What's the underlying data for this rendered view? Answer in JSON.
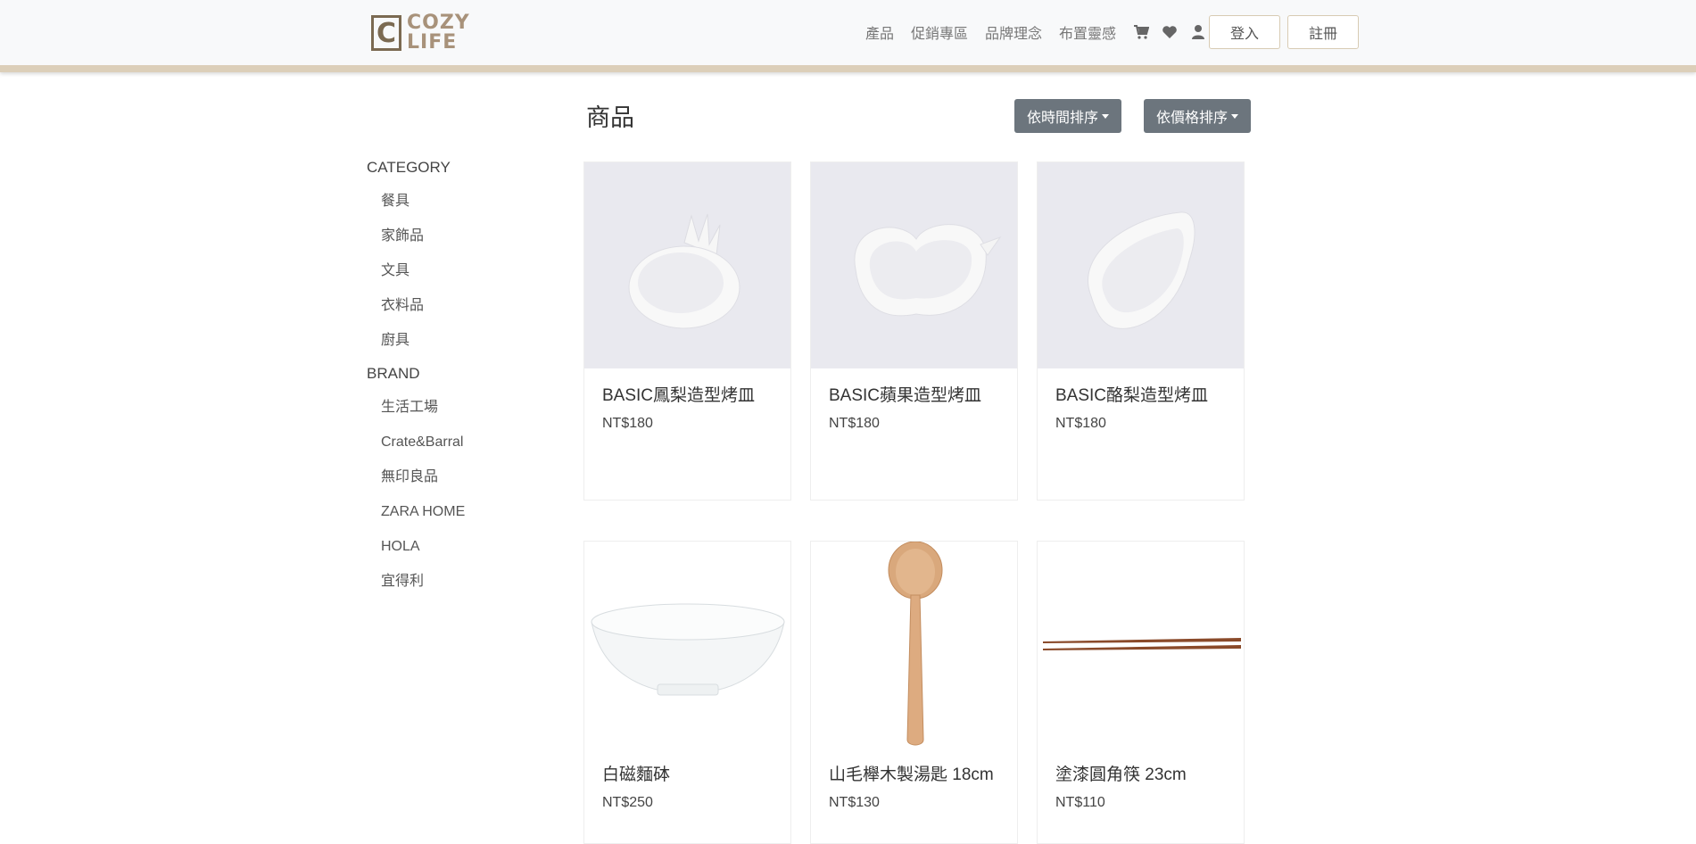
{
  "brand": {
    "logo_letter": "C",
    "line1": "COZY",
    "line2": "LIFE"
  },
  "nav": {
    "links": [
      "產品",
      "促銷專區",
      "品牌理念",
      "布置靈感"
    ],
    "icons": [
      "cart-icon",
      "heart-icon",
      "user-icon"
    ],
    "login_label": "登入",
    "register_label": "註冊"
  },
  "page": {
    "title": "商品",
    "sort_time_label": "依時間排序",
    "sort_price_label": "依價格排序"
  },
  "sidebar": {
    "category_heading": "CATEGORY",
    "categories": [
      "餐具",
      "家飾品",
      "文具",
      "衣料品",
      "廚具"
    ],
    "brand_heading": "BRAND",
    "brands": [
      "生活工場",
      "Crate&Barral",
      "無印良品",
      "ZARA HOME",
      "HOLA",
      "宜得利"
    ]
  },
  "products": [
    {
      "name": "BASIC鳳梨造型烤皿",
      "price": "NT$180",
      "image": "pineapple-dish"
    },
    {
      "name": "BASIC蘋果造型烤皿",
      "price": "NT$180",
      "image": "apple-dish"
    },
    {
      "name": "BASIC酪梨造型烤皿",
      "price": "NT$180",
      "image": "avocado-dish"
    },
    {
      "name": "白磁麵砵",
      "price": "NT$250",
      "image": "white-bowl"
    },
    {
      "name": "山毛櫸木製湯匙 18cm",
      "price": "NT$130",
      "image": "wooden-spoon"
    },
    {
      "name": "塗漆圓角筷 23cm",
      "price": "NT$110",
      "image": "chopsticks"
    }
  ],
  "colors": {
    "sort_button": "#6c757d",
    "accent_border": "#dccfb9",
    "logo": "#7b6a52"
  }
}
